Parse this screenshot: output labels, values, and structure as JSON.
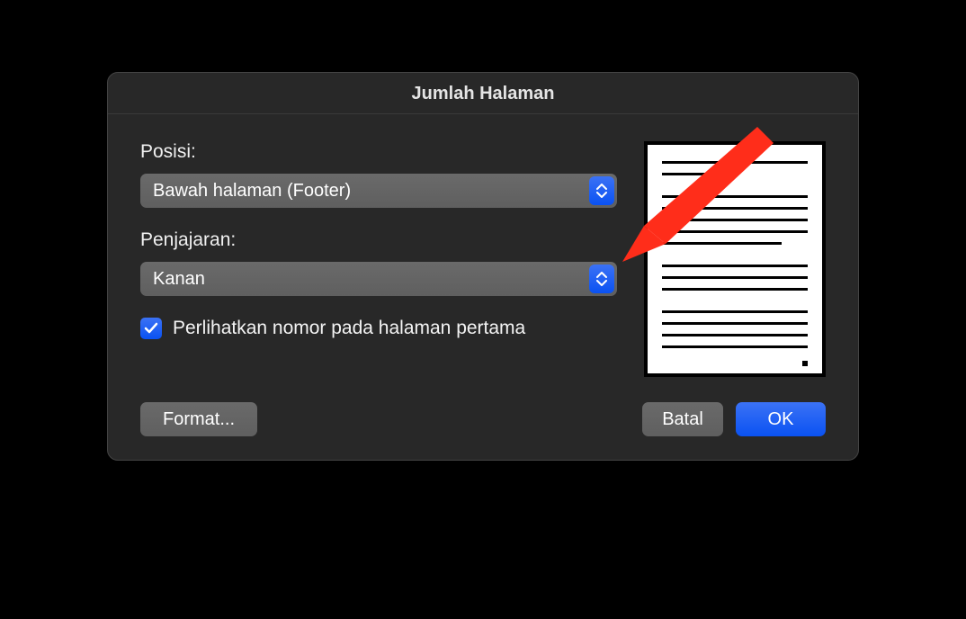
{
  "dialog": {
    "title": "Jumlah Halaman",
    "position_label": "Posisi:",
    "position_value": "Bawah halaman (Footer)",
    "alignment_label": "Penjajaran:",
    "alignment_value": "Kanan",
    "show_first_page_label": "Perlihatkan nomor pada halaman pertama",
    "show_first_page_checked": true,
    "format_button": "Format...",
    "cancel_button": "Batal",
    "ok_button": "OK"
  },
  "annotation": {
    "color": "#ff2d1a"
  }
}
